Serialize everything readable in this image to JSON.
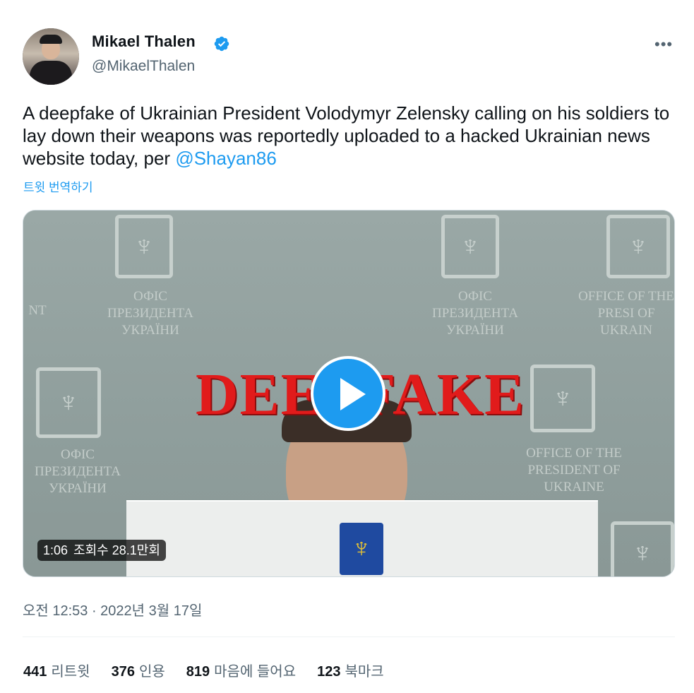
{
  "author": {
    "name": "Mikael Thalen",
    "handle": "@MikaelThalen",
    "verified": true
  },
  "tweet": {
    "text": "A deepfake of Ukrainian President Volodymyr Zelensky calling on his soldiers to lay down their weapons was reportedly uploaded to a hacked Ukrainian news website today, per ",
    "mention": "@Shayan86",
    "translate_label": "트윗 번역하기"
  },
  "media": {
    "overlay_text": "DEEPFAKE",
    "duration": "1:06",
    "views": "조회수 28.1만회",
    "wall_text_left": "ОФІС ПРЕЗИДЕНТА УКРАЇНИ",
    "wall_text_right": "OFFICE OF THE PRESIDENT OF UKRAINE",
    "wall_text_edge": "NT",
    "wall_text_right_edge": "OFFICE OF THE PRESI OF UKRAIN"
  },
  "timestamp": "오전 12:53 · 2022년 3월 17일",
  "stats": [
    {
      "value": "441",
      "label": "리트윗"
    },
    {
      "value": "376",
      "label": "인용"
    },
    {
      "value": "819",
      "label": "마음에 들어요"
    },
    {
      "value": "123",
      "label": "북마크"
    }
  ],
  "icons": {
    "more": "more-icon",
    "verified": "verified-badge-icon",
    "play": "play-icon"
  },
  "colors": {
    "accent": "#1d9bf0",
    "muted": "#536471",
    "deepfake_red": "#e11b1b"
  }
}
